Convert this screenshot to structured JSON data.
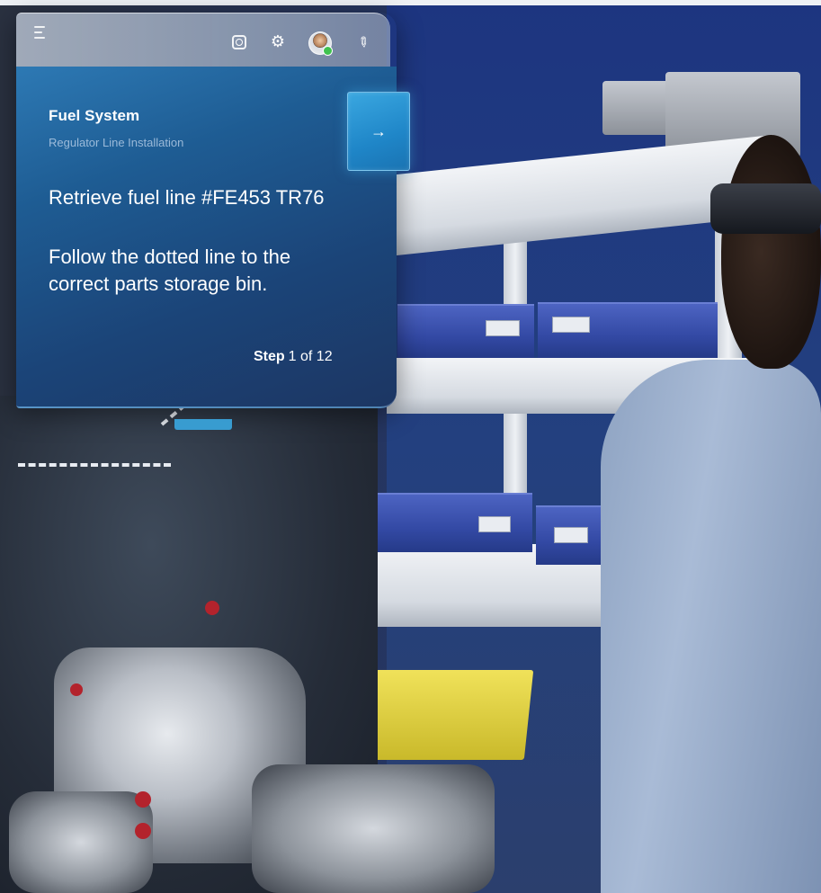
{
  "panel": {
    "title": "Fuel System",
    "subtitle": "Regulator Line Installation",
    "heading": "Retrieve fuel line #FE453 TR76",
    "instruction": "Follow the dotted line to the correct parts storage bin.",
    "step_word": "Step",
    "step_count": "1 of 12",
    "next_arrow": "→"
  },
  "toolbar": {
    "icons": [
      "menu-icon",
      "scan-icon",
      "gear-icon",
      "avatar",
      "pin-icon"
    ],
    "gear_glyph": "⚙",
    "pin_glyph": "✎"
  },
  "colors": {
    "panel_gradient_start": "#2d79b4",
    "panel_gradient_end": "#1c3663",
    "accent": "#3aa7e0",
    "presence_status": "#3fc24f"
  }
}
